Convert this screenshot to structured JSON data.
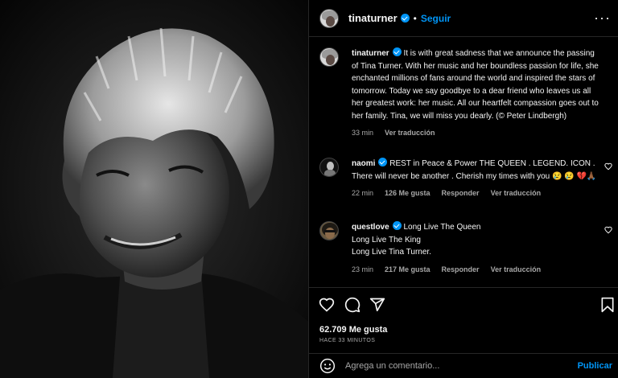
{
  "post": {
    "username": "tinaturner",
    "follow_label": "Seguir",
    "separator": "•",
    "more_label": "···"
  },
  "caption": {
    "username": "tinaturner",
    "text": "It is with great sadness that we announce the passing of Tina Turner. With her music and her boundless passion for life, she enchanted millions of fans around the world and inspired the stars of tomorrow. Today we say goodbye to a dear friend who leaves us all her greatest work: her music. All our heartfelt compassion goes out to her family. Tina, we will miss you dearly. (© Peter Lindbergh)",
    "time": "33 min",
    "translate_label": "Ver traducción"
  },
  "comments": [
    {
      "username": "naomi",
      "text": "REST in Peace & Power THE QUEEN . LEGEND. ICON . There will never be another . Cherish my times with you 😢 😢 💔🙏🏾",
      "time": "22 min",
      "likes": "126 Me gusta",
      "reply_label": "Responder",
      "translate_label": "Ver traducción"
    },
    {
      "username": "questlove",
      "line1": "Long Live The Queen",
      "line2": "Long Live The King",
      "line3": "Long Live Tina Turner.",
      "time": "23 min",
      "likes": "217 Me gusta",
      "reply_label": "Responder",
      "translate_label": "Ver traducción"
    }
  ],
  "stats": {
    "likes": "62.709 Me gusta",
    "time_ago": "HACE 33 MINUTOS"
  },
  "composer": {
    "placeholder": "Agrega un comentario...",
    "publish_label": "Publicar"
  },
  "icons": {
    "like": "heart-icon",
    "comment": "comment-icon",
    "share": "share-icon",
    "save": "bookmark-icon",
    "emoji": "emoji-icon",
    "more": "more-icon",
    "verified": "verified-badge-icon"
  },
  "colors": {
    "accent": "#0095f6",
    "background": "#000000",
    "muted_text": "#a8a8a8"
  }
}
